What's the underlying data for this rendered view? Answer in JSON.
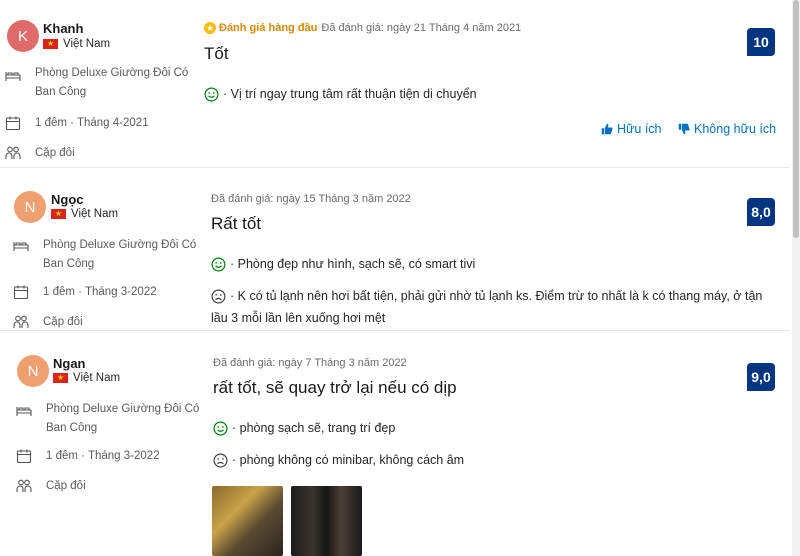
{
  "reviews": [
    {
      "initial": "K",
      "avatar_color": "#e06b6b",
      "name": "Khanh",
      "country": "Việt Nam",
      "room": "Phòng Deluxe Giường Đôi Có Ban Công",
      "stay": "1 đêm · Tháng 4-2021",
      "traveler": "Cặp đôi",
      "badge": "Đánh giá hàng đầu",
      "date": "Đã đánh giá: ngày 21 Tháng 4 năm 2021",
      "title": "Tốt",
      "positive": "· Vị trí ngay trung tâm rất thuận tiện di chuyển",
      "negative": "",
      "score": "10",
      "helpful": "Hữu ích",
      "not_helpful": "Không hữu ích"
    },
    {
      "initial": "N",
      "avatar_color": "#f0a070",
      "name": "Ngọc",
      "country": "Việt Nam",
      "room": "Phòng Deluxe Giường Đôi Có Ban Công",
      "stay": "1 đêm · Tháng 3-2022",
      "traveler": "Cặp đôi",
      "date": "Đã đánh giá: ngày 15 Tháng 3 năm 2022",
      "title": "Rất tốt",
      "positive": "· Phòng đẹp như hình, sạch sẽ, có smart tivi",
      "negative": "· K có tủ lạnh nên hơi bất tiện, phải gửi nhờ tủ lạnh ks. Điểm trừ to nhất là k có thang máy, ở tận lầu 3 mỗi lần lên xuống hơi mệt",
      "score": "8,0"
    },
    {
      "initial": "N",
      "avatar_color": "#f0a070",
      "name": "Ngan",
      "country": "Việt Nam",
      "room": "Phòng Deluxe Giường Đôi Có Ban Công",
      "stay": "1 đêm · Tháng 3-2022",
      "traveler": "Cặp đôi",
      "date": "Đã đánh giá: ngày 7 Tháng 3 năm 2022",
      "title": "rất tốt, sẽ quay trở lại nếu có dịp",
      "positive": "· phòng sạch sẽ, trang trí đẹp",
      "negative": "· phòng không có minibar, không cách âm",
      "score": "9,0"
    }
  ],
  "colors": {
    "accent": "#0071c2",
    "score_bg": "#003580",
    "positive": "#008009",
    "negative": "#262626",
    "badge": "#d38b00"
  },
  "icons": [
    "bed-icon",
    "calendar-icon",
    "people-icon",
    "happy-face-icon",
    "sad-face-icon",
    "thumbs-up-icon",
    "thumbs-down-icon",
    "star-badge-icon"
  ]
}
